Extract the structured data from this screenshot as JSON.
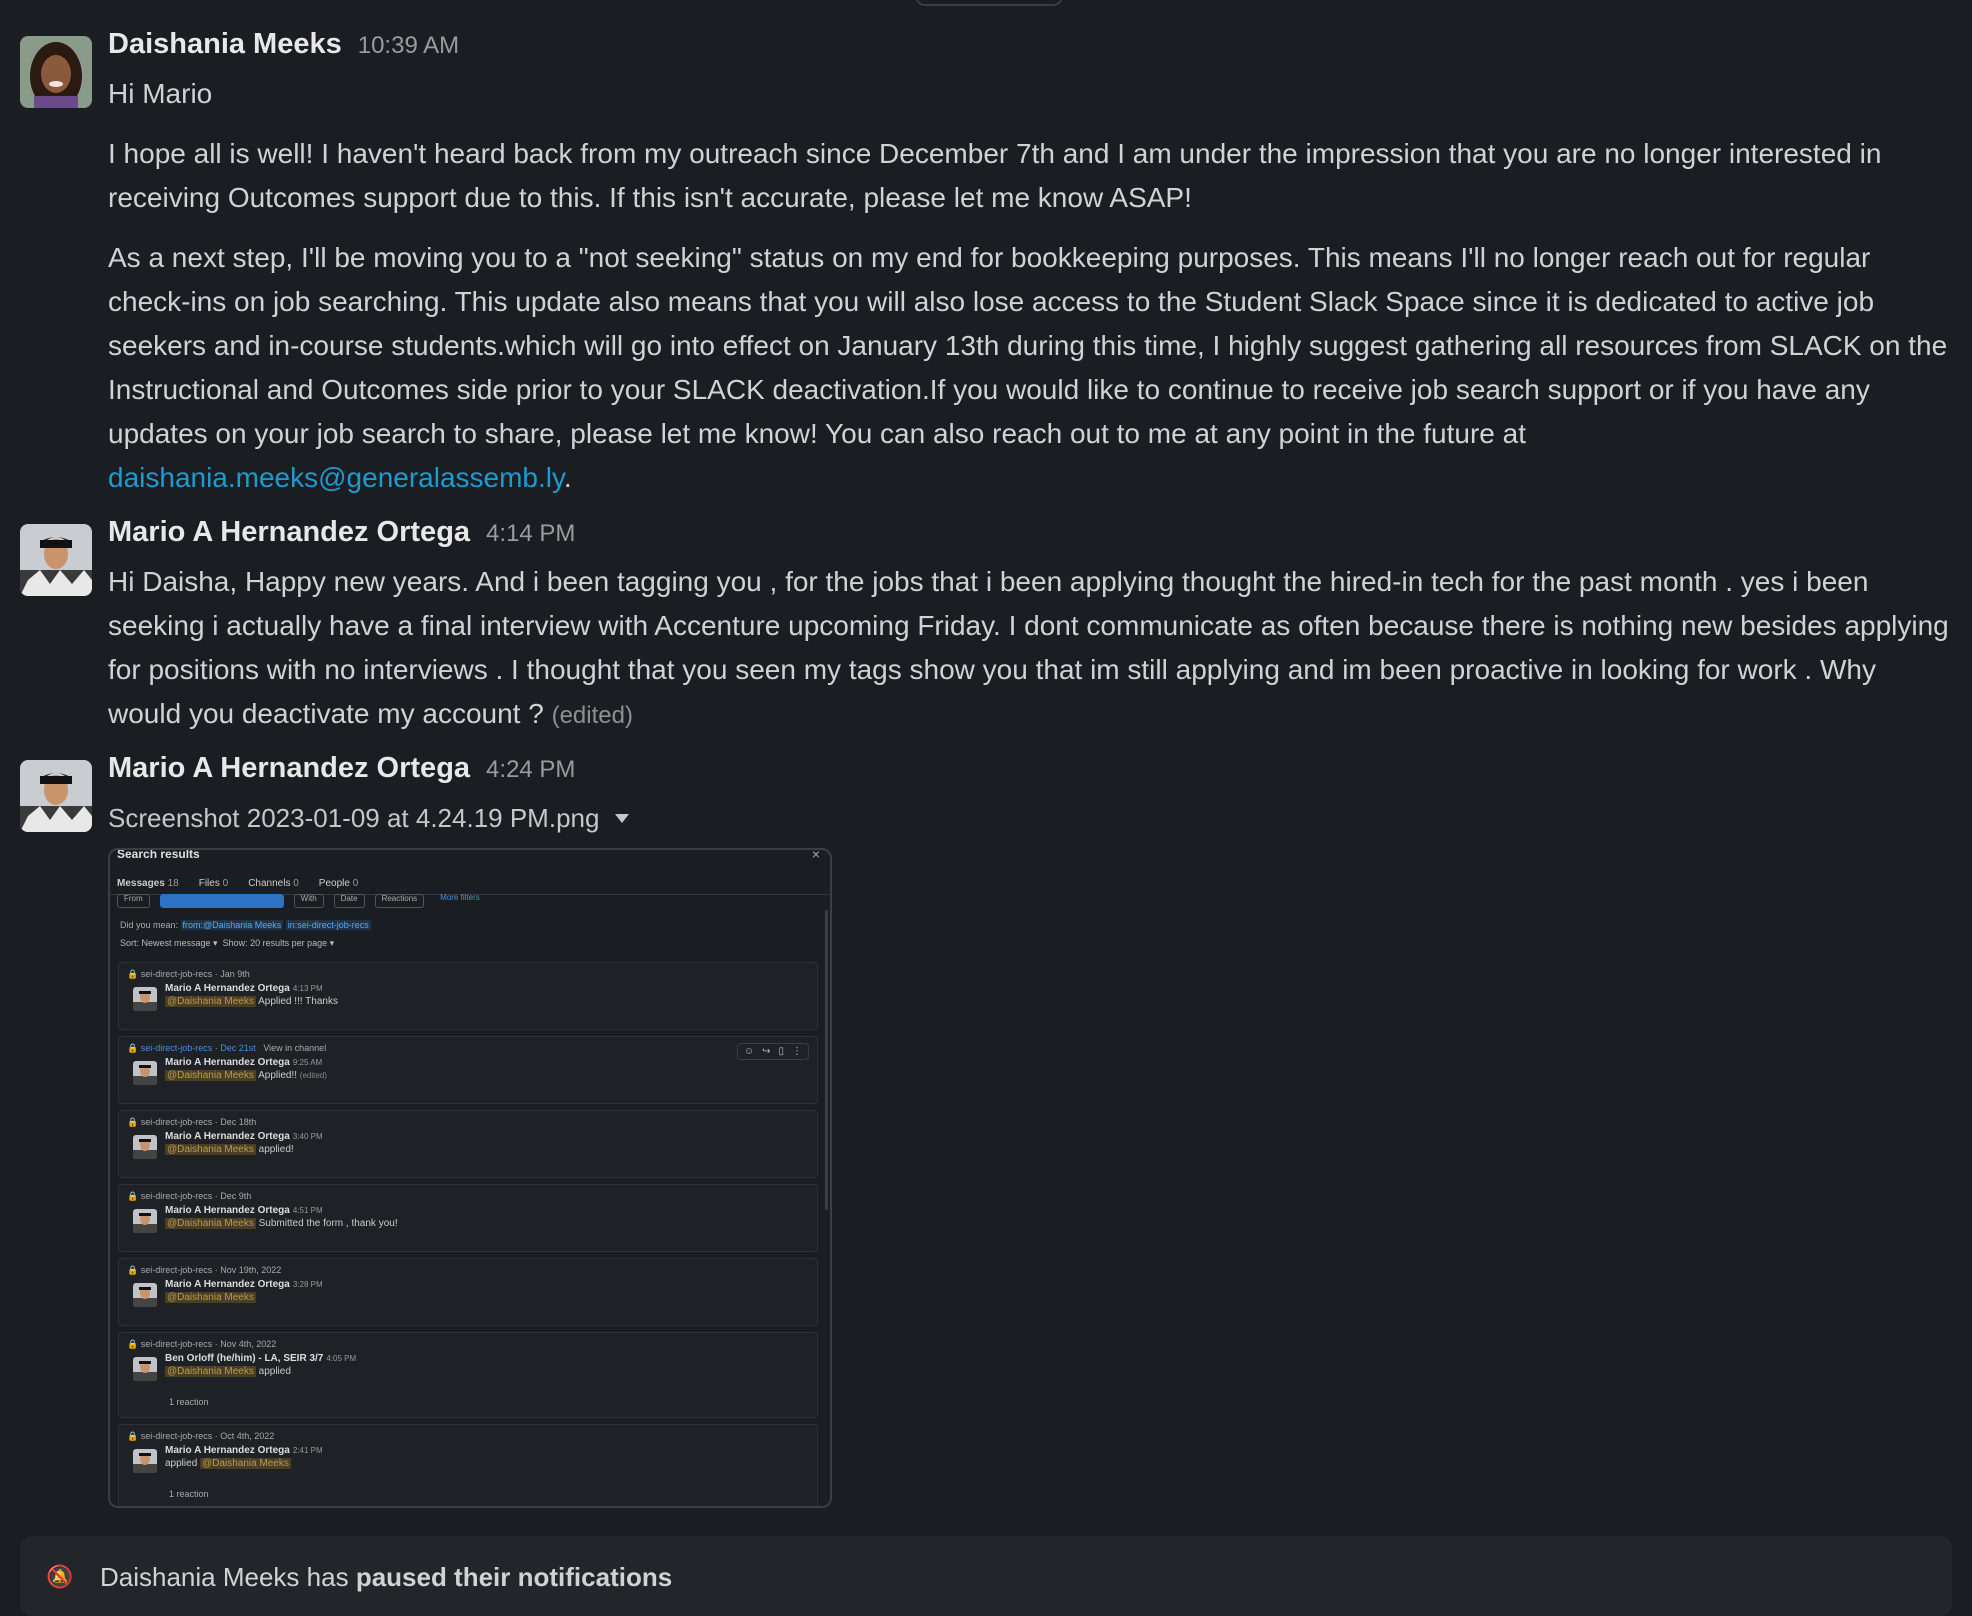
{
  "messages": [
    {
      "sender": "Daishania Meeks",
      "time": "10:39 AM",
      "greeting": "Hi Mario",
      "para1": "I hope all is well! I haven't heard back from my outreach since December 7th and I am under the impression that you are no longer interested in receiving Outcomes support due to this. If this isn't accurate, please let me know ASAP!",
      "para2": "As a next step, I'll be moving you to a \"not seeking\" status on my end for bookkeeping purposes. This means I'll no longer reach out for regular check-ins on job searching. This update also means that you will also lose access to the Student Slack Space since it is dedicated to active job seekers and in-course students.which will go into effect on January 13th during this time, I highly suggest gathering all resources from SLACK on the Instructional and Outcomes side prior to your SLACK deactivation.If you would like to continue to receive job search support or if you have any updates on your job search to share, please let me know! You can also reach out to me at any point in the future at",
      "email": "daishania.meeks@generalassemb.ly",
      "trail": "."
    },
    {
      "sender": "Mario A Hernandez Ortega",
      "time": "4:14 PM",
      "text": "Hi Daisha, Happy new years. And i been tagging you , for the jobs  that i been applying thought the hired-in tech for the past month . yes i been seeking i actually have a final interview with Accenture upcoming Friday.  I dont communicate as often because there is nothing new besides applying for positions with no  interviews .  I thought that you seen  my tags show you that im still applying  and im been proactive in looking for work . Why would you deactivate my account ?",
      "edited": "(edited)"
    },
    {
      "sender": "Mario A Hernandez Ortega",
      "time": "4:24 PM",
      "file_name": "Screenshot 2023-01-09 at 4.24.19 PM.png"
    }
  ],
  "screenshot": {
    "title": "Search results",
    "tabs": [
      {
        "label": "Messages",
        "count": "18"
      },
      {
        "label": "Files",
        "count": "0"
      },
      {
        "label": "Channels",
        "count": "0"
      },
      {
        "label": "People",
        "count": "0"
      }
    ],
    "filters": [
      "From",
      "",
      "With",
      "Date",
      "Reactions",
      "More filters"
    ],
    "did_you_mean_label": "Did you mean:",
    "did_you_mean_query": "from:@Daishania Meeks",
    "did_you_mean_channel": "in:sei-direct-job-recs",
    "sort": "Sort: Newest message",
    "show": "Show: 20 results per page",
    "results": [
      {
        "channel": "sei-direct-job-recs",
        "date": "Jan 9th",
        "name": "Mario A Hernandez Ortega",
        "time": "4:13 PM",
        "mention": "@Daishania Meeks",
        "text": "Applied !!! Thanks",
        "reaction": ""
      },
      {
        "channel": "sei-direct-job-recs",
        "date": "Dec 21st",
        "view": "View in channel",
        "name": "Mario A Hernandez Ortega",
        "time": "9:25 AM",
        "mention": "@Daishania Meeks",
        "text": "Applied!!",
        "edited": "(edited)",
        "reaction": ""
      },
      {
        "channel": "sei-direct-job-recs",
        "date": "Dec 18th",
        "name": "Mario A Hernandez Ortega",
        "time": "3:40 PM",
        "mention": "@Daishania Meeks",
        "text": "applied!",
        "reaction": ""
      },
      {
        "channel": "sei-direct-job-recs",
        "date": "Dec 9th",
        "name": "Mario A Hernandez Ortega",
        "time": "4:51 PM",
        "mention": "@Daishania Meeks",
        "text": "Submitted the form , thank you!",
        "reaction": ""
      },
      {
        "channel": "sei-direct-job-recs",
        "date": "Nov 19th, 2022",
        "name": "Mario A Hernandez Ortega",
        "time": "3:28 PM",
        "mention": "@Daishania Meeks",
        "text": "",
        "reaction": ""
      },
      {
        "channel": "sei-direct-job-recs",
        "date": "Nov 4th, 2022",
        "name": "Ben Orloff (he/him) - LA, SEIR 3/7",
        "time": "4:05 PM",
        "mention": "@Daishania Meeks",
        "text": "applied",
        "reaction": "1 reaction"
      },
      {
        "channel": "sei-direct-job-recs",
        "date": "Oct 4th, 2022",
        "name": "Mario A Hernandez Ortega",
        "time": "2:41 PM",
        "mention": "@Daishania Meeks",
        "text": "applied",
        "reaction": "1 reaction"
      }
    ]
  },
  "banner": {
    "prefix": "Daishania Meeks has",
    "bold": "paused their notifications"
  },
  "colors": {
    "background": "#1a1d21",
    "link": "#1d9bd1",
    "mention_bg": "#4a3f24"
  },
  "icons": [
    "avatar",
    "chevron-down-icon",
    "close-icon",
    "lock-icon",
    "bell-pause-icon"
  ]
}
